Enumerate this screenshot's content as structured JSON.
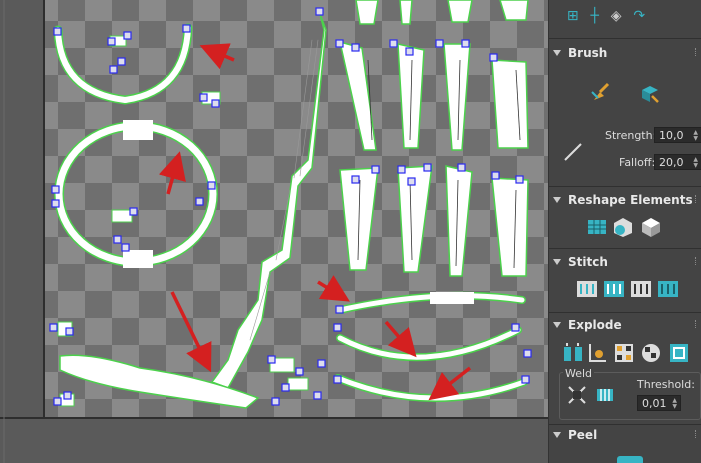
{
  "panel": {
    "brush": {
      "title": "Brush",
      "strength_label": "Strength:",
      "strength_value": "10,0",
      "falloff_label": "Falloff:",
      "falloff_value": "20,0"
    },
    "reshape": {
      "title": "Reshape Elements"
    },
    "stitch": {
      "title": "Stitch"
    },
    "explode": {
      "title": "Explode",
      "weld_label": "Weld",
      "threshold_label": "Threshold:",
      "threshold_value": "0,01"
    },
    "peel": {
      "title": "Peel"
    }
  },
  "colors": {
    "viewport_bg": "#3a3a3a",
    "checker_light": "#8a8a8a",
    "checker_dark": "#6f6f6f",
    "uv_edge": "#4cd14c",
    "selection_marker": "#2a2af0",
    "annotation_arrow": "#d42020",
    "icon_teal": "#37b4c4"
  },
  "icons": [
    "brush-relax-icon",
    "brush-pinch-icon",
    "falloff-line-icon",
    "reshape-straighten-icon",
    "reshape-relax-icon",
    "reshape-flatten-icon",
    "stitch-icons",
    "explode-icons",
    "weld-icons"
  ]
}
